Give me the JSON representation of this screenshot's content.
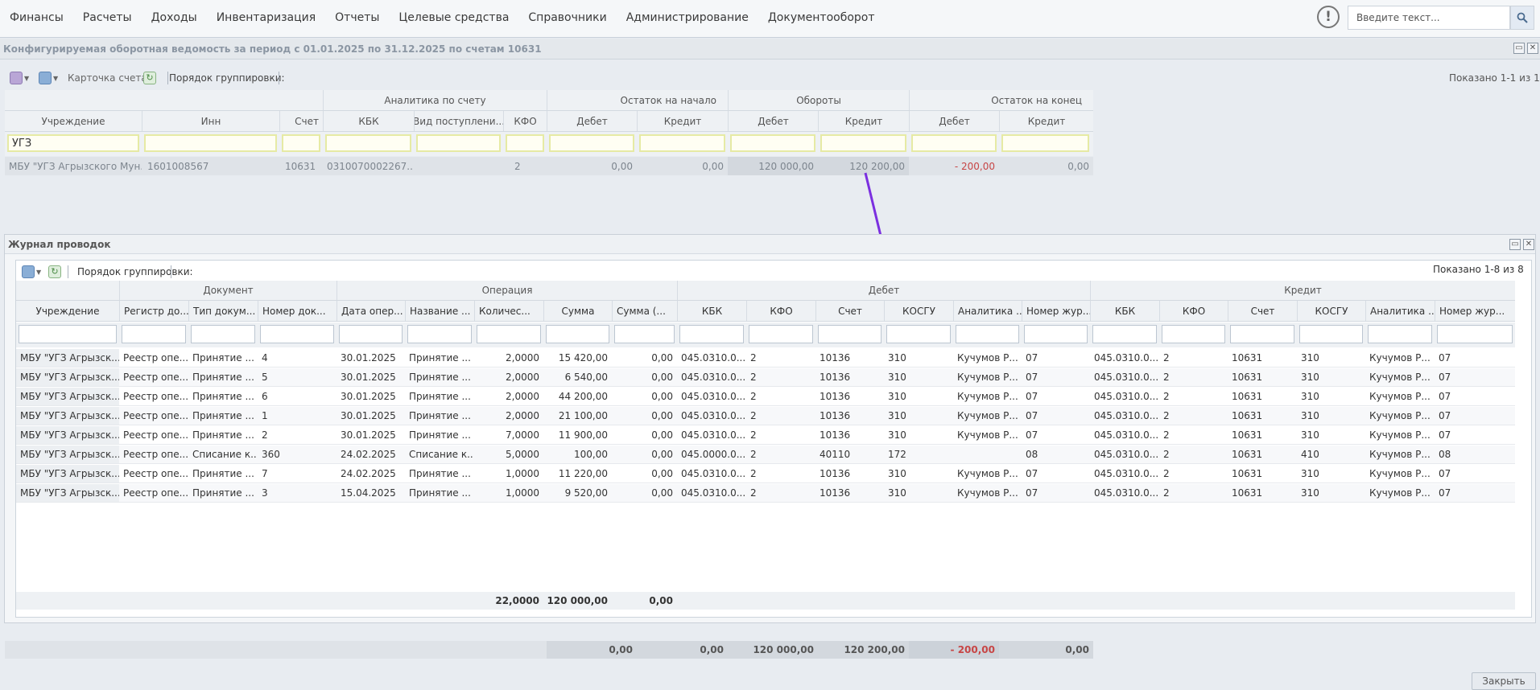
{
  "menu": [
    "Финансы",
    "Расчеты",
    "Доходы",
    "Инвентаризация",
    "Отчеты",
    "Целевые средства",
    "Справочники",
    "Администрирование",
    "Документооборот"
  ],
  "search": {
    "placeholder": "Введите текст..."
  },
  "window1": {
    "title": "Конфигурируемая оборотная ведомость за период с 01.01.2025 по 31.12.2025 по счетам 10631",
    "toolbar": {
      "card_label": "Карточка счета",
      "grouping_label": "Порядок группировки:",
      "shown": "Показано 1-1 из 1"
    },
    "group_headers": {
      "analytics": "Аналитика по счету",
      "opening": "Остаток на начало",
      "turnover": "Обороты",
      "closing": "Остаток на конец"
    },
    "columns": [
      "Учреждение",
      "Инн",
      "Счет",
      "КБК",
      "Вид поступлени...",
      "КФО",
      "Дебет",
      "Кредит",
      "Дебет",
      "Кредит",
      "Дебет",
      "Кредит"
    ],
    "filter_value": "УГЗ",
    "row": [
      "МБУ \"УГЗ Агрызского Мун...",
      "1601008567",
      "10631",
      "0310070002267...",
      "",
      "2",
      "0,00",
      "0,00",
      "120 000,00",
      "120 200,00",
      "- 200,00",
      "0,00"
    ],
    "totals": [
      "0,00",
      "0,00",
      "120 000,00",
      "120 200,00",
      "- 200,00",
      "0,00"
    ]
  },
  "window2": {
    "title": "Журнал проводок",
    "toolbar": {
      "grouping_label": "Порядок группировки:",
      "shown": "Показано 1-8 из 8"
    },
    "group_headers": {
      "document": "Документ",
      "operation": "Операция",
      "debit": "Дебет",
      "credit": "Кредит"
    },
    "columns": [
      "Учреждение",
      "Регистр до...",
      "Тип докум...",
      "Номер док...",
      "Дата опер...",
      "Название ...",
      "Количес...",
      "Сумма",
      "Сумма (...",
      "КБК",
      "КФО",
      "Счет",
      "КОСГУ",
      "Аналитика ...",
      "Номер жур...",
      "КБК",
      "КФО",
      "Счет",
      "КОСГУ",
      "Аналитика ...",
      "Номер жур..."
    ],
    "rows": [
      [
        "МБУ \"УГЗ Агрызск...",
        "Реестр опе...",
        "Принятие ...",
        "4",
        "30.01.2025",
        "Принятие ...",
        "2,0000",
        "15 420,00",
        "0,00",
        "045.0310.0...",
        "2",
        "10136",
        "310",
        "Кучумов Р...",
        "07",
        "045.0310.0...",
        "2",
        "10631",
        "310",
        "Кучумов Р...",
        "07"
      ],
      [
        "МБУ \"УГЗ Агрызск...",
        "Реестр опе...",
        "Принятие ...",
        "5",
        "30.01.2025",
        "Принятие ...",
        "2,0000",
        "6 540,00",
        "0,00",
        "045.0310.0...",
        "2",
        "10136",
        "310",
        "Кучумов Р...",
        "07",
        "045.0310.0...",
        "2",
        "10631",
        "310",
        "Кучумов Р...",
        "07"
      ],
      [
        "МБУ \"УГЗ Агрызск...",
        "Реестр опе...",
        "Принятие ...",
        "6",
        "30.01.2025",
        "Принятие ...",
        "2,0000",
        "44 200,00",
        "0,00",
        "045.0310.0...",
        "2",
        "10136",
        "310",
        "Кучумов Р...",
        "07",
        "045.0310.0...",
        "2",
        "10631",
        "310",
        "Кучумов Р...",
        "07"
      ],
      [
        "МБУ \"УГЗ Агрызск...",
        "Реестр опе...",
        "Принятие ...",
        "1",
        "30.01.2025",
        "Принятие ...",
        "2,0000",
        "21 100,00",
        "0,00",
        "045.0310.0...",
        "2",
        "10136",
        "310",
        "Кучумов Р...",
        "07",
        "045.0310.0...",
        "2",
        "10631",
        "310",
        "Кучумов Р...",
        "07"
      ],
      [
        "МБУ \"УГЗ Агрызск...",
        "Реестр опе...",
        "Принятие ...",
        "2",
        "30.01.2025",
        "Принятие ...",
        "7,0000",
        "11 900,00",
        "0,00",
        "045.0310.0...",
        "2",
        "10136",
        "310",
        "Кучумов Р...",
        "07",
        "045.0310.0...",
        "2",
        "10631",
        "310",
        "Кучумов Р...",
        "07"
      ],
      [
        "МБУ \"УГЗ Агрызск...",
        "Реестр опе...",
        "Списание к...",
        "360",
        "24.02.2025",
        "Списание к...",
        "5,0000",
        "100,00",
        "0,00",
        "045.0000.0...",
        "2",
        "40110",
        "172",
        "",
        "08",
        "045.0310.0...",
        "2",
        "10631",
        "410",
        "Кучумов Р...",
        "08"
      ],
      [
        "МБУ \"УГЗ Агрызск...",
        "Реестр опе...",
        "Принятие ...",
        "7",
        "24.02.2025",
        "Принятие ...",
        "1,0000",
        "11 220,00",
        "0,00",
        "045.0310.0...",
        "2",
        "10136",
        "310",
        "Кучумов Р...",
        "07",
        "045.0310.0...",
        "2",
        "10631",
        "310",
        "Кучумов Р...",
        "07"
      ],
      [
        "МБУ \"УГЗ Агрызск...",
        "Реестр опе...",
        "Принятие ...",
        "3",
        "15.04.2025",
        "Принятие ...",
        "1,0000",
        "9 520,00",
        "0,00",
        "045.0310.0...",
        "2",
        "10136",
        "310",
        "Кучумов Р...",
        "07",
        "045.0310.0...",
        "2",
        "10631",
        "310",
        "Кучумов Р...",
        "07"
      ]
    ],
    "totals": {
      "quantity": "22,0000",
      "sum": "120 000,00",
      "sum2": "0,00"
    }
  },
  "close_label": "Закрыть",
  "colors": {
    "arrow": "#7b2fe0",
    "negative": "#c74545"
  }
}
